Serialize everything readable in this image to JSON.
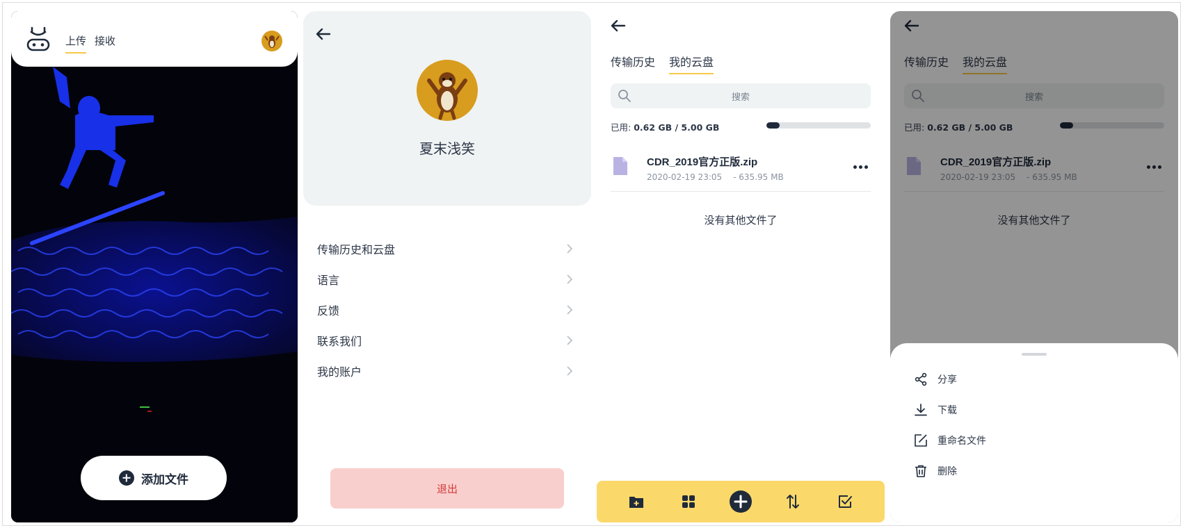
{
  "panel_upload": {
    "tabs": [
      "上传",
      "接收"
    ],
    "active_tab": 0,
    "add_file_label": "添加文件"
  },
  "panel_profile": {
    "username": "夏末浅笑",
    "menu": [
      "传输历史和云盘",
      "语言",
      "反馈",
      "联系我们",
      "我的账户"
    ],
    "logout_label": "退出"
  },
  "panel_cloud": {
    "tabs": [
      "传输历史",
      "我的云盘"
    ],
    "active_tab": 1,
    "search_placeholder": "搜索",
    "usage_label": "已用: ",
    "usage_value": "0.62 GB / 5.00 GB",
    "usage_fraction": 0.124,
    "file": {
      "name": "CDR_2019官方正版.zip",
      "date": "2020-02-19 23:05",
      "size": "- 635.95 MB"
    },
    "empty_hint": "没有其他文件了",
    "toolbar": [
      "new-folder-icon",
      "grid-view-icon",
      "add-circle-icon",
      "sort-icon",
      "select-icon"
    ]
  },
  "panel_actions": {
    "actions": [
      {
        "label": "分享",
        "icon": "share-icon"
      },
      {
        "label": "下载",
        "icon": "download-icon"
      },
      {
        "label": "重命名文件",
        "icon": "rename-icon"
      },
      {
        "label": "删除",
        "icon": "delete-icon"
      }
    ]
  },
  "colors": {
    "accent_yellow": "#f6c945",
    "toolbar_yellow": "#fbd86a",
    "dark_navy": "#1f2a3a",
    "logout_bg": "#f9cfcd",
    "logout_text": "#d33a3a",
    "card_bg": "#eff3f3"
  }
}
